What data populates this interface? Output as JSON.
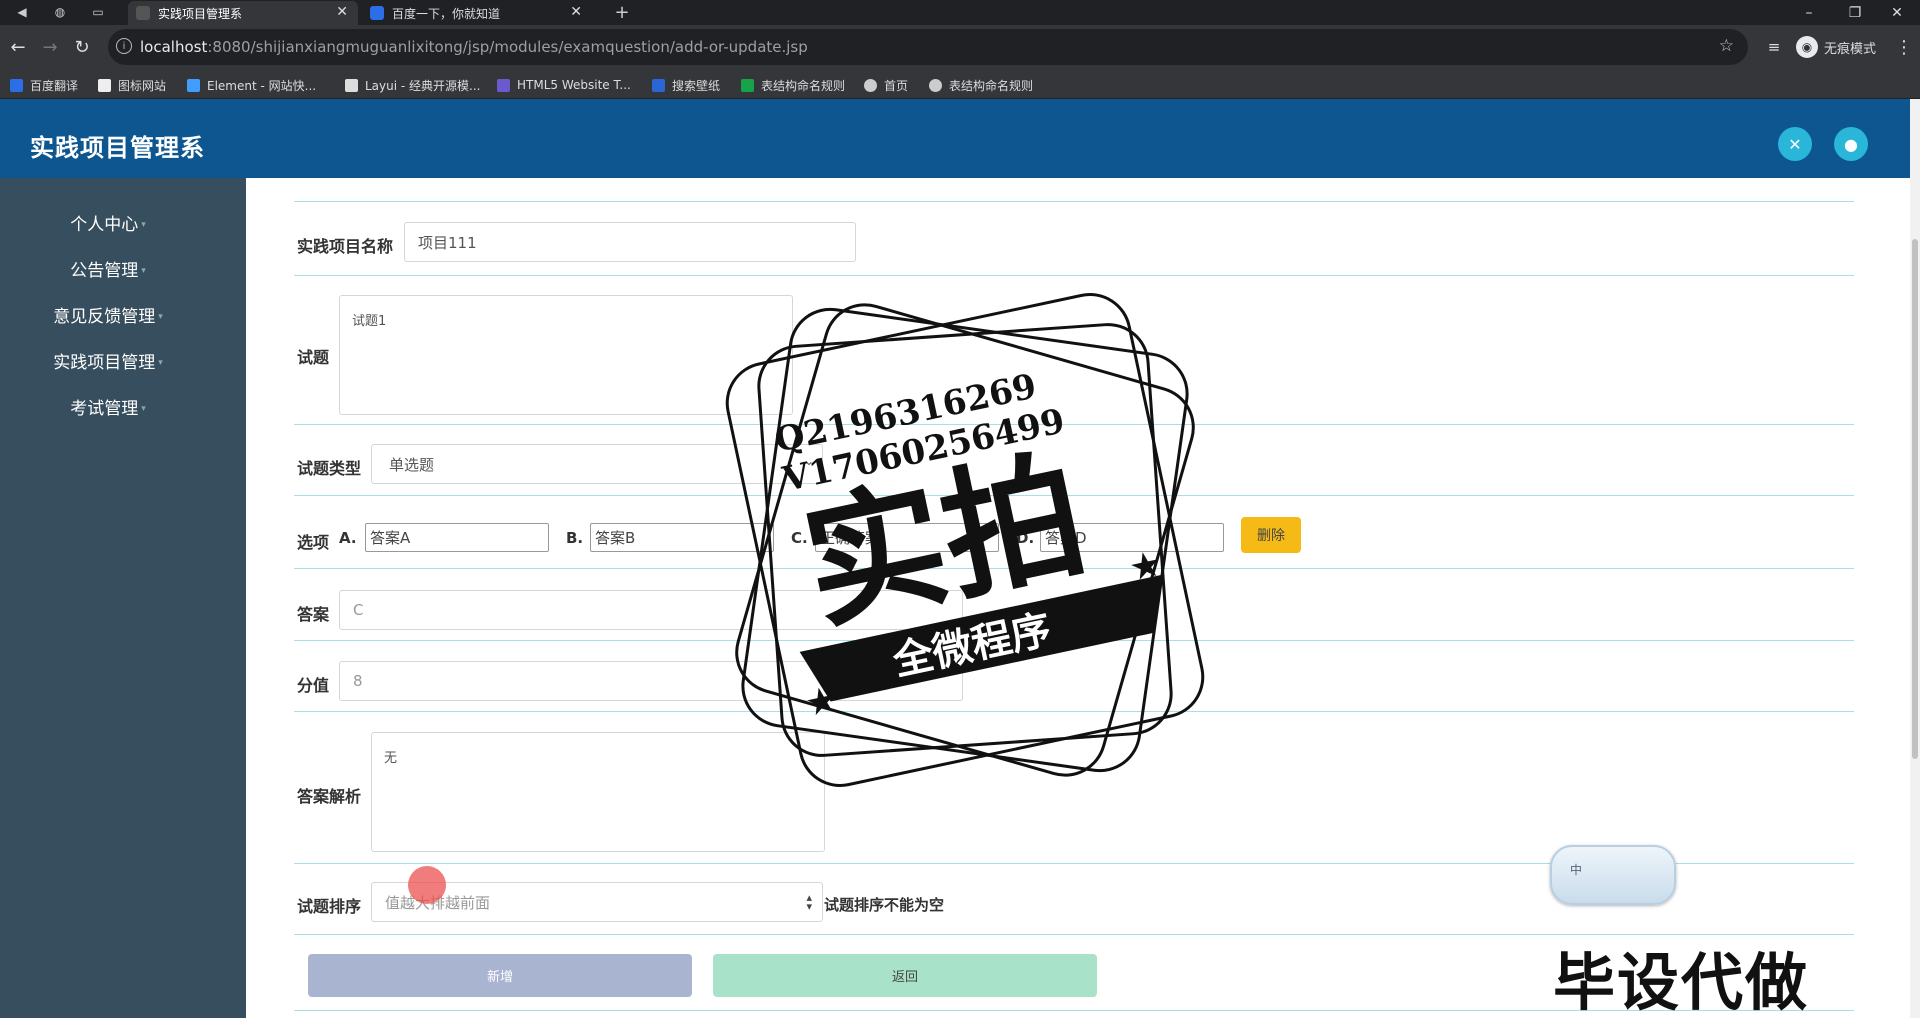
{
  "browser": {
    "tabs": [
      {
        "title": "实践项目管理系",
        "active": true
      },
      {
        "title": "百度一下，你就知道",
        "active": false
      }
    ],
    "new_tab": "+",
    "url_host": "localhost",
    "url_rest": ":8080/shijianxiangmuguanlixitong/jsp/modules/examquestion/add-or-update.jsp",
    "incognito_label": "无痕模式",
    "bookmarks": [
      {
        "label": "百度翻译",
        "color": "#2b6ee8"
      },
      {
        "label": "图标网站",
        "color": "#eeeeee"
      },
      {
        "label": "Element - 网站快...",
        "color": "#409eff"
      },
      {
        "label": "Layui - 经典开源模...",
        "color": "#dddddd"
      },
      {
        "label": "HTML5 Website T...",
        "color": "#6a5acd"
      },
      {
        "label": "搜索壁纸",
        "color": "#2a66d6"
      },
      {
        "label": "表结构命名规则",
        "color": "#16a34a"
      },
      {
        "label": "首页",
        "color": "#cccccc"
      },
      {
        "label": "表结构命名规则",
        "color": "#cccccc"
      }
    ]
  },
  "app": {
    "title": "实践项目管理系",
    "colors": {
      "header": "#0d568f",
      "sidebar": "#374e5e",
      "accent": "#29b6d9"
    }
  },
  "sidebar": {
    "items": [
      {
        "label": "个人中心"
      },
      {
        "label": "公告管理"
      },
      {
        "label": "意见反馈管理"
      },
      {
        "label": "实践项目管理"
      },
      {
        "label": "考试管理"
      }
    ]
  },
  "form": {
    "project_name_label": "实践项目名称",
    "project_name_value": "项目111",
    "question_label": "试题",
    "question_value": "试题1",
    "type_label": "试题类型",
    "type_value": "单选题",
    "options_label": "选项",
    "option_a_label": "A.",
    "option_a_value": "答案A",
    "option_b_label": "B.",
    "option_b_value": "答案B",
    "option_c_label": "C.",
    "option_c_value": "正确答案",
    "option_d_label": "D.",
    "option_d_value": "答案D",
    "delete_label": "删除",
    "answer_label": "答案",
    "answer_value": "C",
    "score_label": "分值",
    "score_value": "8",
    "analysis_label": "答案解析",
    "analysis_value": "无",
    "sort_label": "试题排序",
    "sort_placeholder": "值越大排越前面",
    "sort_error": "试题排序不能为空",
    "add_label": "新增",
    "back_label": "返回"
  },
  "overlay": {
    "stamp_contact_1": "Q2196316269",
    "stamp_contact_2": "V17060256499",
    "stamp_main": "实拍",
    "stamp_banner": "全微程序",
    "watermark": "毕设代做",
    "ime_label": "中"
  }
}
